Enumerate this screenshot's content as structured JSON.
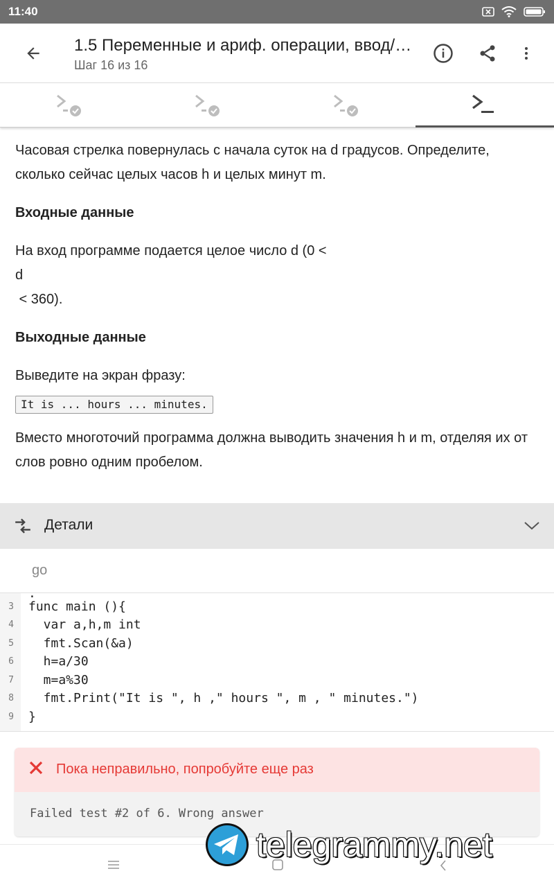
{
  "status_bar": {
    "time": "11:40"
  },
  "app_bar": {
    "title": "1.5 Переменные и ариф. операции, ввод/…",
    "subtitle": "Шаг 16 из 16"
  },
  "step_tabs": {
    "count": 4,
    "active_index": 3
  },
  "content": {
    "paragraph1": "Часовая стрелка повернулась с начала суток на d градусов. Определите, сколько сейчас целых часов h и целых минут m.",
    "input_heading": "Входные данные",
    "input_line1": "На вход программе подается целое число d (0 <",
    "input_line2": "d",
    "input_line3": " < 360).",
    "output_heading": "Выходные данные",
    "output_intro": "Выведите на экран фразу:",
    "output_code": "It is ... hours ... minutes.",
    "paragraph_last": "Вместо многоточий программа должна выводить значения h и m, отделяя их от слов ровно одним пробелом."
  },
  "details": {
    "label": "Детали"
  },
  "language": "go",
  "code": {
    "lines": [
      {
        "no": "3",
        "text": "func main (){"
      },
      {
        "no": "4",
        "text": "  var a,h,m int"
      },
      {
        "no": "5",
        "text": "  fmt.Scan(&a)"
      },
      {
        "no": "6",
        "text": "  h=a/30"
      },
      {
        "no": "7",
        "text": "  m=a%30"
      },
      {
        "no": "8",
        "text": "  fmt.Print(\"It is \", h ,\" hours \", m , \" minutes.\")"
      },
      {
        "no": "9",
        "text": "}"
      }
    ]
  },
  "result": {
    "message": "Пока неправильно, попробуйте еще раз",
    "detail": "Failed test #2 of 6. Wrong answer"
  },
  "watermark": {
    "text": "telegrammy.net"
  },
  "colors": {
    "status_bar": "#6f6f6f",
    "error_text": "#e53935",
    "error_bg": "#fde3e3",
    "details_bg": "#e6e6e6"
  }
}
